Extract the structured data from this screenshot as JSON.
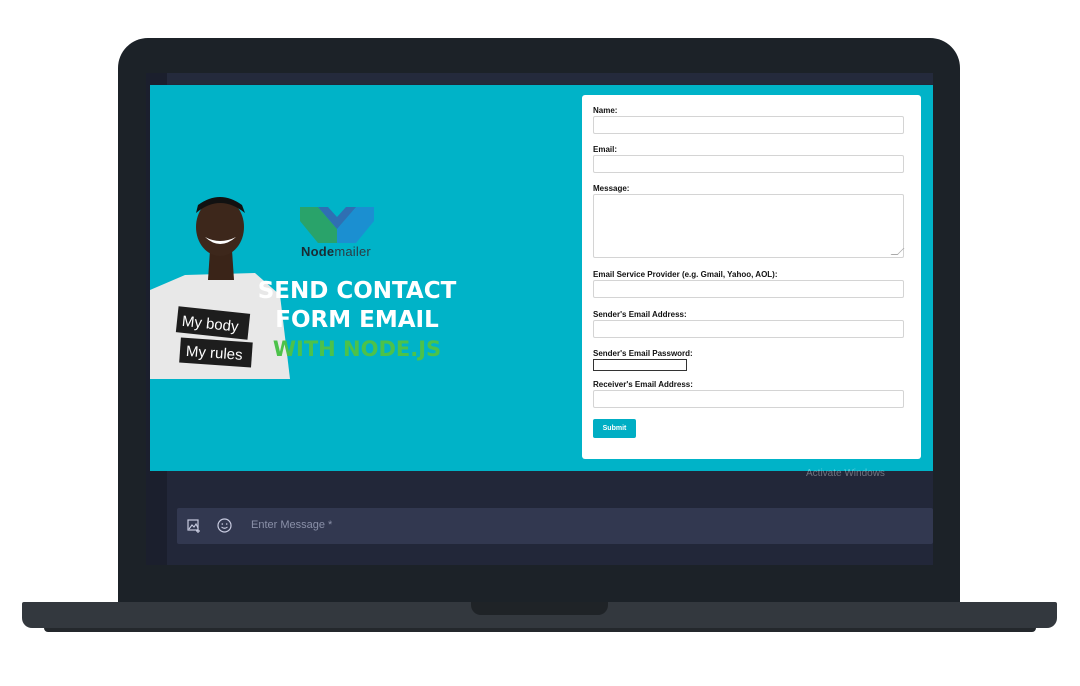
{
  "banner": {
    "logo_word_bold": "Node",
    "logo_word_rest": "mailer",
    "headline_line1": "SEND CONTACT",
    "headline_line2": "FORM EMAIL",
    "headline_line3": "WITH NODE.JS",
    "shirt_text_1": "My body",
    "shirt_text_2": "My rules"
  },
  "form": {
    "name_label": "Name:",
    "email_label": "Email:",
    "message_label": "Message:",
    "provider_label": "Email Service Provider (e.g. Gmail, Yahoo, AOL):",
    "sender_email_label": "Sender's Email Address:",
    "sender_password_label": "Sender's Email Password:",
    "receiver_email_label": "Receiver's Email Address:",
    "submit_label": "Submit"
  },
  "watermark": "Activate Windows",
  "message_bar": {
    "placeholder": "Enter Message *",
    "image_icon": "image-add-icon",
    "emoji_icon": "emoji-icon"
  },
  "colors": {
    "banner_bg": "#00b3c8",
    "submit_bg": "#00aec4",
    "headline_accent": "#4cc24a",
    "screen_bg": "#222739"
  }
}
